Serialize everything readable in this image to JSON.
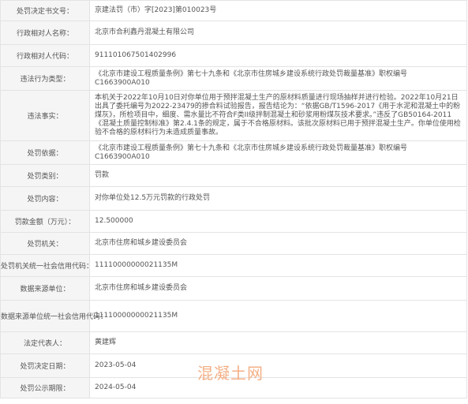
{
  "rows": [
    {
      "label": "处罚决定书文号：",
      "value": "京建法罚（市）字[2023]第010023号"
    },
    {
      "label": "行政相对人名称：",
      "value": "北京市合利鑫丹混凝土有限公司"
    },
    {
      "label": "行政相对人代码：",
      "value": "91110106750140​2996"
    },
    {
      "label": "违法行为类型：",
      "value": "《北京市建设工程质量条例》第七十九条和《北京市住房城乡建设系统行政处罚裁量基准》职权编号C1663900A010"
    },
    {
      "label": "违法事实：",
      "value": "本机关于2022年10月10日对你单位用于预拌混凝土生产的原材料质量进行现场抽样并进行检验。2022年10月21日出具了委托编号为2022-23479的掺合料试验报告，报告结论为：“依据GB/T1596-2017《用于水泥和混凝土中的粉煤灰》，所检项目中，细度、需水量比不符合F类II级拌制混凝土和砂浆用粉煤灰技术要求。”违反了GB50164-2011《混凝土质量控制标准》第2.4.1条的规定，属于不合格原材料。该批次原材料已用于预拌混凝土生产。你单位使用检验不合格的原材料行为未造成质量事故。"
    },
    {
      "label": "处罚依据：",
      "value": "《北京市建设工程质量条例》第七十九条和《北京市住房城乡建设系统行政处罚裁量基准》职权编号C1663900A010"
    },
    {
      "label": "处罚类别：",
      "value": "罚款"
    },
    {
      "label": "处罚内容：",
      "value": "对你单位处12.5万元罚款的行政处罚"
    },
    {
      "label": "罚款金额（万元）：",
      "value": "12.500000"
    },
    {
      "label": "处罚机关：",
      "value": "北京市住房和城乡建设委员会"
    },
    {
      "label": "处罚机关统一社会信用代码：",
      "value": "11110000000021135M"
    },
    {
      "label": "数据来源单位：",
      "value": "北京市住房和城乡建设委员会"
    },
    {
      "label": "数据来源单位统一社会信用代码：",
      "value": "11110000000021135M"
    },
    {
      "label": "法定代表人：",
      "value": "黄建辉"
    },
    {
      "label": "处罚决定日期：",
      "value": "2023-05-04"
    },
    {
      "label": "处罚公示期限：",
      "value": "2024-05-04"
    }
  ],
  "watermark": "混凝土网"
}
